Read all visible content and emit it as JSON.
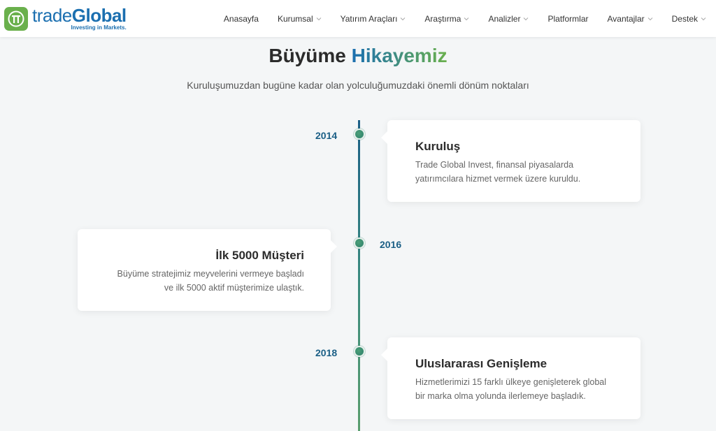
{
  "header": {
    "logo": {
      "word_light": "trade",
      "word_bold": "Global",
      "tagline": "Investing in Markets."
    },
    "nav": [
      {
        "label": "Anasayfa",
        "dropdown": false
      },
      {
        "label": "Kurumsal",
        "dropdown": true
      },
      {
        "label": "Yatırım Araçları",
        "dropdown": true
      },
      {
        "label": "Araştırma",
        "dropdown": true
      },
      {
        "label": "Analizler",
        "dropdown": true
      },
      {
        "label": "Platformlar",
        "dropdown": false
      },
      {
        "label": "Avantajlar",
        "dropdown": true
      },
      {
        "label": "Destek",
        "dropdown": true
      }
    ]
  },
  "section": {
    "title_main": "Büyüme ",
    "title_accent": "Hikayemiz",
    "subtitle": "Kuruluşumuzdan bugüne kadar olan yolculuğumuzdaki önemli dönüm noktaları"
  },
  "milestones": [
    {
      "year": "2014",
      "title": "Kuruluş",
      "desc_line1": "Trade Global Invest, finansal piyasalarda",
      "desc_line2": "yatırımcılara hizmet vermek üzere kuruldu."
    },
    {
      "year": "2016",
      "title": "İlk 5000 Müşteri",
      "desc_line1": "Büyüme stratejimiz meyvelerini vermeye başladı",
      "desc_line2": "ve ilk 5000 aktif müşterimize ulaştık."
    },
    {
      "year": "2018",
      "title": "Uluslararası Genişleme",
      "desc_line1": "Hizmetlerimizi 15 farklı ülkeye genişleterek global",
      "desc_line2": "bir marka olma yolunda ilerlemeye başladık."
    }
  ],
  "colors": {
    "brand_blue": "#1b6fb0",
    "brand_green": "#6ab04c",
    "timeline": "#1b5f86"
  }
}
